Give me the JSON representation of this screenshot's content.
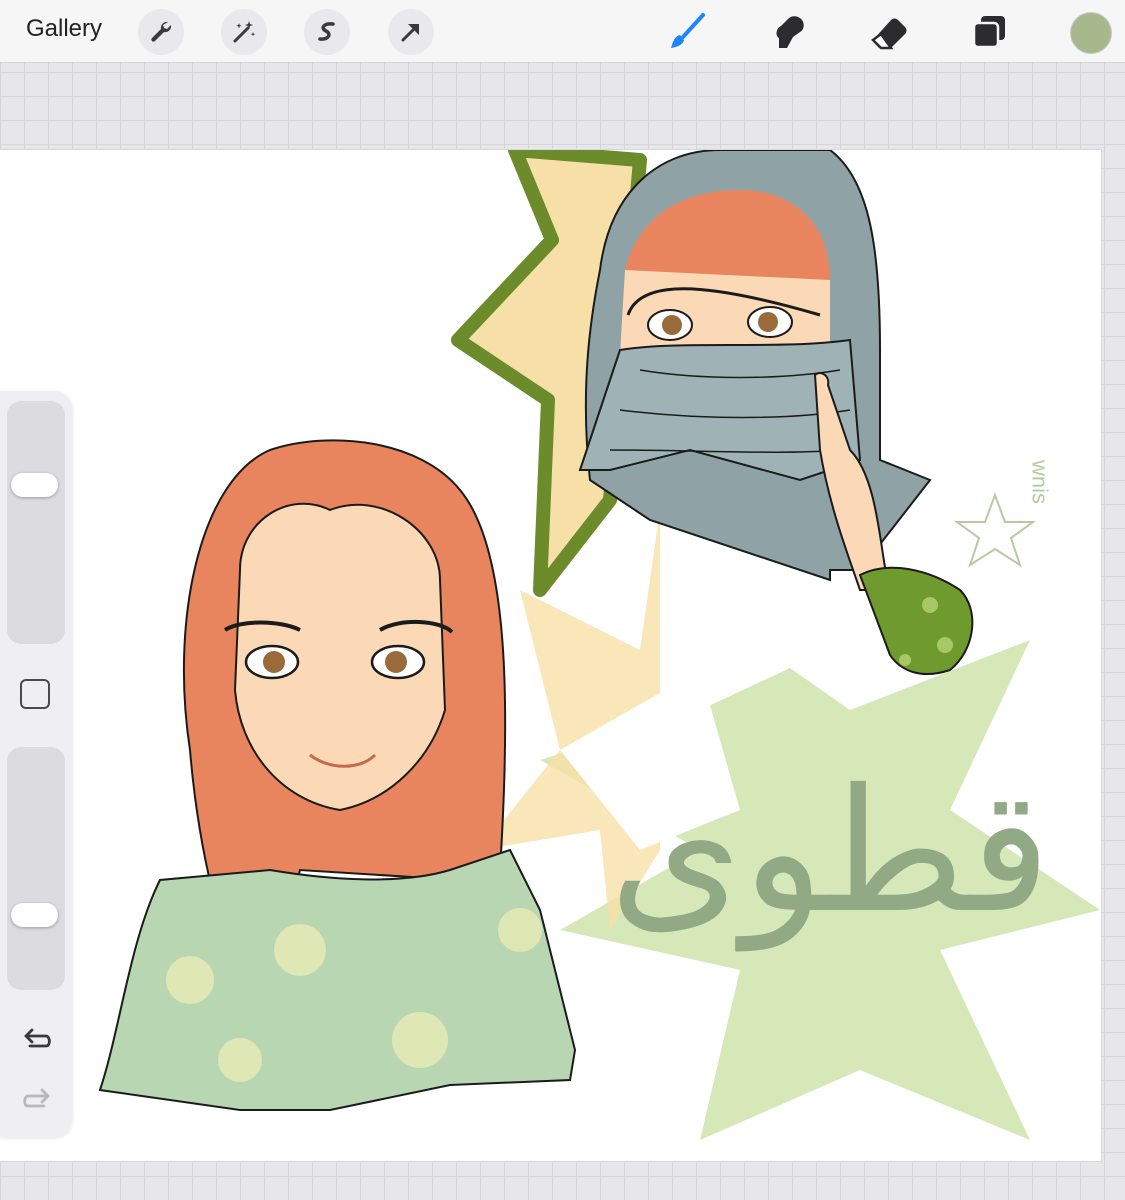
{
  "toolbar": {
    "gallery_label": "Gallery",
    "left_tools": [
      {
        "icon": "wrench-icon",
        "name": "actions"
      },
      {
        "icon": "magic-wand-icon",
        "name": "adjustments"
      },
      {
        "icon": "selection-icon",
        "name": "selection"
      },
      {
        "icon": "arrow-icon",
        "name": "transform"
      }
    ],
    "right_tools": [
      {
        "icon": "brush-icon",
        "name": "paint",
        "active": true
      },
      {
        "icon": "smudge-icon",
        "name": "smudge",
        "active": false
      },
      {
        "icon": "eraser-icon",
        "name": "eraser",
        "active": false
      },
      {
        "icon": "layers-icon",
        "name": "layers",
        "active": false
      }
    ],
    "current_color": "#a7b98c",
    "accent_color": "#1f86ff"
  },
  "sidebar": {
    "brush_size_level": 0.68,
    "opacity_level": 0.28,
    "modify_icon": "square-icon",
    "undo_icon": "undo-icon",
    "redo_icon": "redo-icon"
  },
  "artwork": {
    "arabic_text": "قطوى",
    "signature": "wnis",
    "colors": {
      "hair": "#e8855e",
      "skin": "#fbd9b6",
      "scarf": "#9fb3b6",
      "shirt": "#b9d6b3",
      "star_dark": "#6c8b2a",
      "star_light": "#d6e8b8",
      "star_peach": "#f7e0a8",
      "glove": "#6f9a2e",
      "lettering": "#92a986"
    }
  }
}
